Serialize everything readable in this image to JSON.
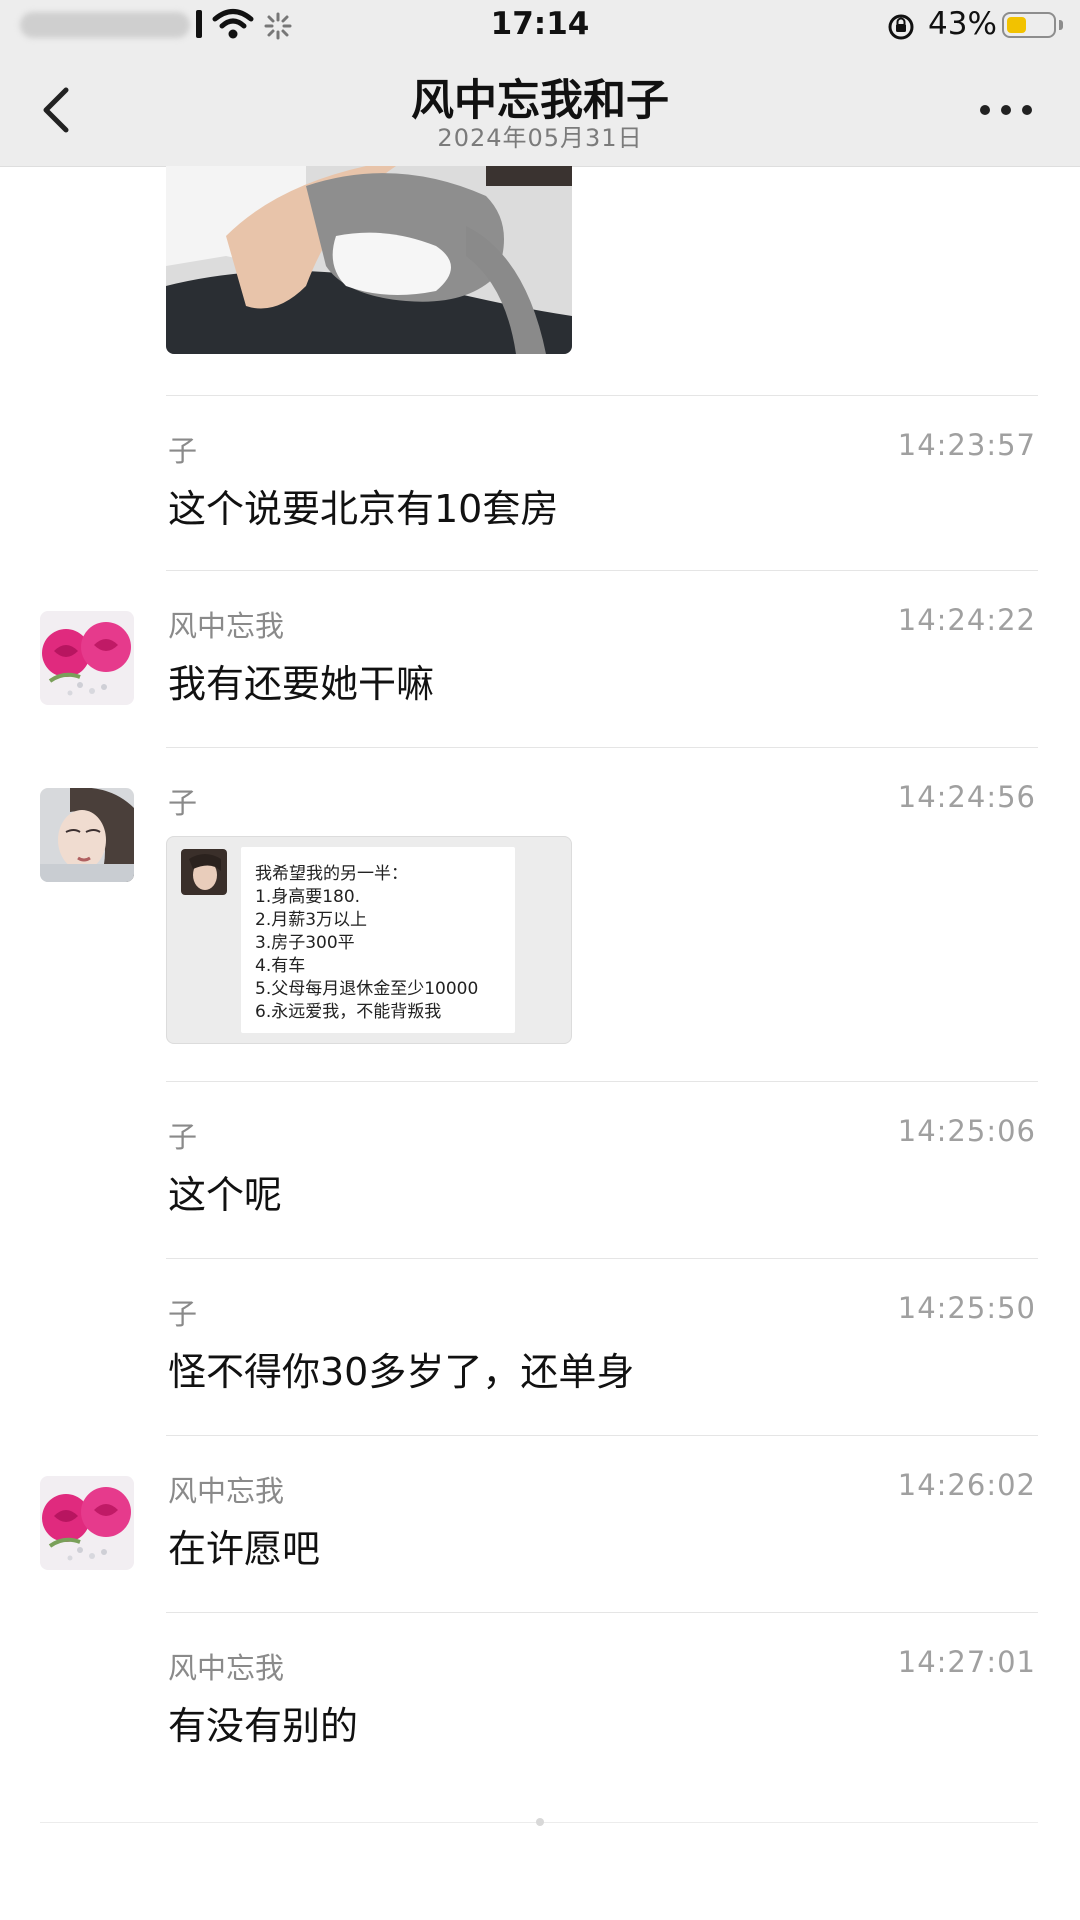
{
  "status_bar": {
    "time": "17:14",
    "battery_percent": "43%",
    "battery_level": 0.43,
    "battery_color": "#f2c200"
  },
  "header": {
    "back_icon": "chevron-left-icon",
    "title": "风中忘我和子",
    "subtitle": "2024年05月31日",
    "more_icon": "more-dots-icon"
  },
  "photo": {
    "description_icon": "cat-photo"
  },
  "messages": [
    {
      "sender": "子",
      "time": "14:23:57",
      "text": "这个说要北京有10套房",
      "avatar": "none"
    },
    {
      "sender": "风中忘我",
      "time": "14:24:22",
      "text": "我有还要她干嘛",
      "avatar": "roses"
    },
    {
      "sender": "子",
      "time": "14:24:56",
      "text": "",
      "avatar": "girl"
    },
    {
      "sender": "子",
      "time": "14:25:06",
      "text": "这个呢",
      "avatar": "none"
    },
    {
      "sender": "子",
      "time": "14:25:50",
      "text": "怪不得你30多岁了，还单身",
      "avatar": "none"
    },
    {
      "sender": "风中忘我",
      "time": "14:26:02",
      "text": "在许愿吧",
      "avatar": "roses"
    },
    {
      "sender": "风中忘我",
      "time": "14:27:01",
      "text": "有没有别的",
      "avatar": "none"
    }
  ],
  "card": {
    "lines": [
      "我希望我的另一半：",
      "1.身高要180.",
      "2.月薪3万以上",
      "3.房子300平",
      "4.有车",
      "5.父母每月退休金至少10000",
      "6.永远爱我，不能背叛我"
    ]
  }
}
